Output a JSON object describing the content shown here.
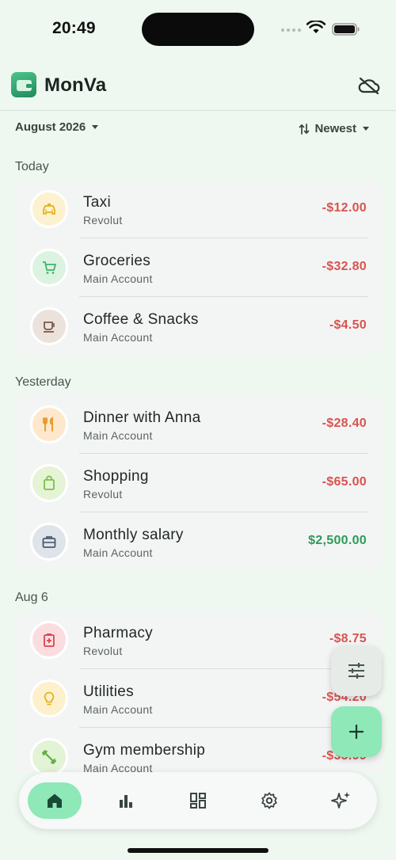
{
  "status_bar": {
    "time": "20:49"
  },
  "header": {
    "title": "MonVa"
  },
  "toolbar": {
    "month": "August 2026",
    "sort": "Newest"
  },
  "groups": [
    {
      "label": "Today",
      "items": [
        {
          "title": "Taxi",
          "account": "Revolut",
          "amount": "-$12.00",
          "icon": "taxi-icon"
        },
        {
          "title": "Groceries",
          "account": "Main Account",
          "amount": "-$32.80",
          "icon": "cart-icon"
        },
        {
          "title": "Coffee & Snacks",
          "account": "Main Account",
          "amount": "-$4.50",
          "icon": "coffee-icon"
        }
      ]
    },
    {
      "label": "Yesterday",
      "items": [
        {
          "title": "Dinner with Anna",
          "account": "Main Account",
          "amount": "-$28.40",
          "icon": "restaurant-icon"
        },
        {
          "title": "Shopping",
          "account": "Revolut",
          "amount": "-$65.00",
          "icon": "shopping-bag-icon"
        },
        {
          "title": "Monthly salary",
          "account": "Main Account",
          "amount": "$2,500.00",
          "icon": "briefcase-icon"
        }
      ]
    },
    {
      "label": "Aug 6",
      "items": [
        {
          "title": "Pharmacy",
          "account": "Revolut",
          "amount": "-$8.75",
          "icon": "medical-icon"
        },
        {
          "title": "Utilities",
          "account": "Main Account",
          "amount": "-$54.20",
          "icon": "lightbulb-icon"
        },
        {
          "title": "Gym membership",
          "account": "Main Account",
          "amount": "-$35.99",
          "icon": "fitness-icon"
        }
      ]
    }
  ],
  "colors": {
    "accent": "#8ee8b8",
    "expense": "#d9534f",
    "income": "#2e9a58",
    "background": "#eef8f0"
  },
  "nav": [
    "home-icon",
    "stats-icon",
    "dashboard-icon",
    "settings-icon",
    "sparkle-icon"
  ]
}
